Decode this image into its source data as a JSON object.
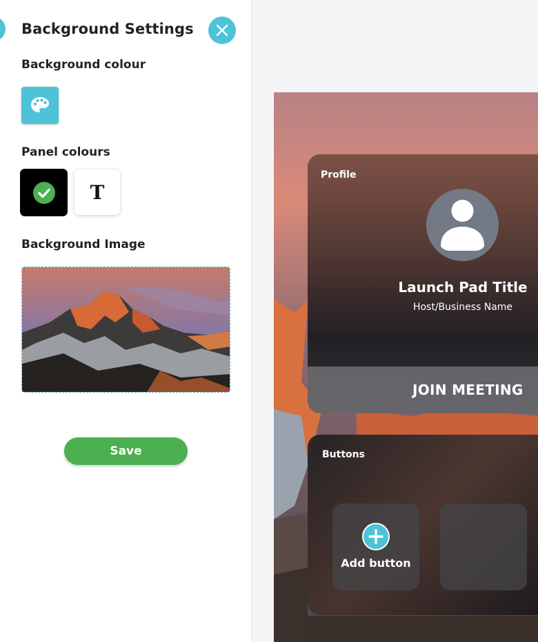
{
  "panel": {
    "title": "Background Settings",
    "background_colour_label": "Background colour",
    "panel_colours_label": "Panel colours",
    "panel_colour_text_option": "T",
    "background_image_label": "Background Image",
    "save_label": "Save"
  },
  "preview": {
    "profile_label": "Profile",
    "title": "Launch Pad Title",
    "subtitle": "Host/Business Name",
    "join_label": "JOIN MEETING",
    "buttons_label": "Buttons",
    "add_button_label": "Add button"
  },
  "colors": {
    "accent": "#4ec3d8",
    "save": "#4caf50",
    "selected_check": "#4caf50"
  },
  "icons": {
    "close": "close-icon",
    "palette": "palette-icon",
    "check": "check-icon",
    "avatar": "user-icon",
    "add": "plus-icon"
  }
}
